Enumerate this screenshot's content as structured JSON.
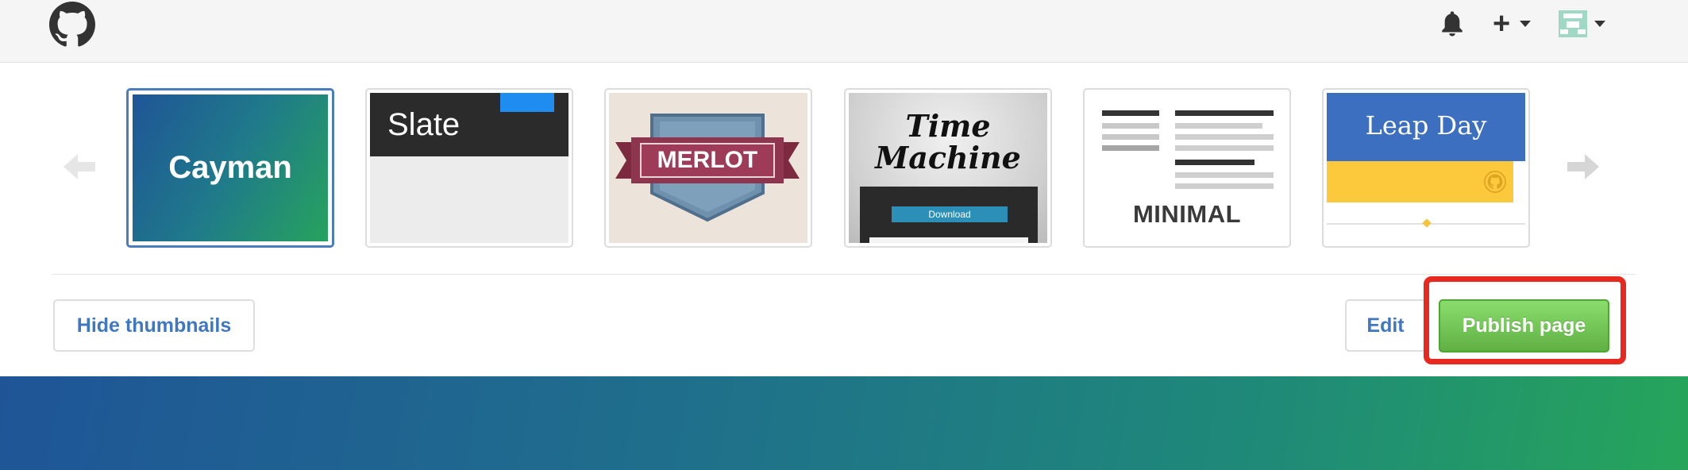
{
  "header": {
    "icons": [
      "github-logo",
      "bell-icon",
      "plus-icon",
      "chevron-down-icon",
      "avatar"
    ]
  },
  "themes": [
    {
      "name": "Cayman",
      "label": "Cayman",
      "selected": true
    },
    {
      "name": "Slate",
      "label": "Slate",
      "selected": false
    },
    {
      "name": "Merlot",
      "label": "MERLOT",
      "selected": false
    },
    {
      "name": "Time Machine",
      "label_line1": "Time",
      "label_line2": "Machine",
      "button": "Download",
      "selected": false
    },
    {
      "name": "Minimal",
      "label": "MINIMAL",
      "selected": false
    },
    {
      "name": "Leap Day",
      "label": "Leap Day",
      "selected": false
    }
  ],
  "carousel": {
    "prev_icon": "arrow-left-icon",
    "next_icon": "arrow-right-icon"
  },
  "actions": {
    "hide_thumbnails": "Hide thumbnails",
    "edit": "Edit",
    "publish": "Publish page"
  },
  "colors": {
    "accent_link": "#4078c0",
    "publish_green": "#60b044",
    "highlight_red": "#e8291f",
    "selected_border": "#4a7dbd"
  }
}
